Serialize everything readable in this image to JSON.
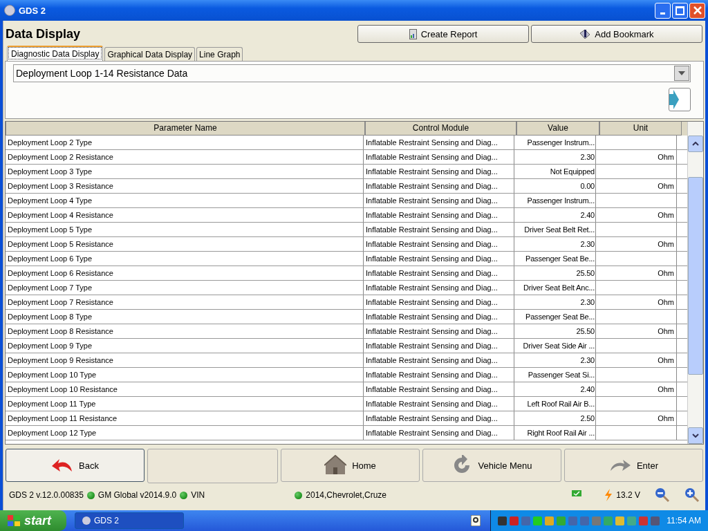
{
  "window": {
    "title": "GDS 2"
  },
  "page_title": "Data Display",
  "header_buttons": [
    "Create Report",
    "Add Bookmark"
  ],
  "tabs": [
    {
      "label": "Diagnostic Data Display",
      "selected": true
    },
    {
      "label": "Graphical Data Display",
      "selected": false
    },
    {
      "label": "Line Graph",
      "selected": false
    }
  ],
  "data_list": {
    "value": "Deployment Loop 1-14 Resistance Data"
  },
  "table": {
    "columns": [
      "Parameter Name",
      "Control Module",
      "Value",
      "Unit"
    ],
    "rows": [
      [
        "Deployment Loop 2 Type",
        "Inflatable Restraint Sensing and Diag...",
        "Passenger Instrum...",
        ""
      ],
      [
        "Deployment Loop 2 Resistance",
        "Inflatable Restraint Sensing and Diag...",
        "2.30",
        "Ohm"
      ],
      [
        "Deployment Loop 3 Type",
        "Inflatable Restraint Sensing and Diag...",
        "Not Equipped",
        ""
      ],
      [
        "Deployment Loop 3 Resistance",
        "Inflatable Restraint Sensing and Diag...",
        "0.00",
        "Ohm"
      ],
      [
        "Deployment Loop 4 Type",
        "Inflatable Restraint Sensing and Diag...",
        "Passenger Instrum...",
        ""
      ],
      [
        "Deployment Loop 4 Resistance",
        "Inflatable Restraint Sensing and Diag...",
        "2.40",
        "Ohm"
      ],
      [
        "Deployment Loop 5 Type",
        "Inflatable Restraint Sensing and Diag...",
        "Driver Seat Belt Ret...",
        ""
      ],
      [
        "Deployment Loop 5 Resistance",
        "Inflatable Restraint Sensing and Diag...",
        "2.30",
        "Ohm"
      ],
      [
        "Deployment Loop 6 Type",
        "Inflatable Restraint Sensing and Diag...",
        "Passenger Seat Be...",
        ""
      ],
      [
        "Deployment Loop 6 Resistance",
        "Inflatable Restraint Sensing and Diag...",
        "25.50",
        "Ohm"
      ],
      [
        "Deployment Loop 7 Type",
        "Inflatable Restraint Sensing and Diag...",
        "Driver Seat Belt Anc...",
        ""
      ],
      [
        "Deployment Loop 7 Resistance",
        "Inflatable Restraint Sensing and Diag...",
        "2.30",
        "Ohm"
      ],
      [
        "Deployment Loop 8 Type",
        "Inflatable Restraint Sensing and Diag...",
        "Passenger Seat Be...",
        ""
      ],
      [
        "Deployment Loop 8 Resistance",
        "Inflatable Restraint Sensing and Diag...",
        "25.50",
        "Ohm"
      ],
      [
        "Deployment Loop 9 Type",
        "Inflatable Restraint Sensing and Diag...",
        "Driver Seat Side Air ...",
        ""
      ],
      [
        "Deployment Loop 9 Resistance",
        "Inflatable Restraint Sensing and Diag...",
        "2.30",
        "Ohm"
      ],
      [
        "Deployment Loop 10 Type",
        "Inflatable Restraint Sensing and Diag...",
        "Passenger Seat Si...",
        ""
      ],
      [
        "Deployment Loop 10 Resistance",
        "Inflatable Restraint Sensing and Diag...",
        "2.40",
        "Ohm"
      ],
      [
        "Deployment Loop 11 Type",
        "Inflatable Restraint Sensing and Diag...",
        "Left Roof Rail Air B...",
        ""
      ],
      [
        "Deployment Loop 11 Resistance",
        "Inflatable Restraint Sensing and Diag...",
        "2.50",
        "Ohm"
      ],
      [
        "Deployment Loop 12 Type",
        "Inflatable Restraint Sensing and Diag...",
        "Right Roof Rail Air ...",
        ""
      ]
    ]
  },
  "nav_buttons": [
    {
      "kind": "back",
      "label": "Back"
    },
    {
      "kind": "blank"
    },
    {
      "kind": "home",
      "label": "Home"
    },
    {
      "kind": "vehicle",
      "label": "Vehicle Menu"
    },
    {
      "kind": "enter",
      "label": "Enter"
    }
  ],
  "status_bar": {
    "version": "GDS 2 v.12.0.00835",
    "items": [
      "GM Global v2014.9.0",
      "VIN",
      "2014,Chevrolet,Cruze"
    ],
    "voltage": "13.2 V"
  },
  "taskbar": {
    "start": "start",
    "tasks": [
      "GDS 2"
    ],
    "clock": "11:54 AM"
  }
}
